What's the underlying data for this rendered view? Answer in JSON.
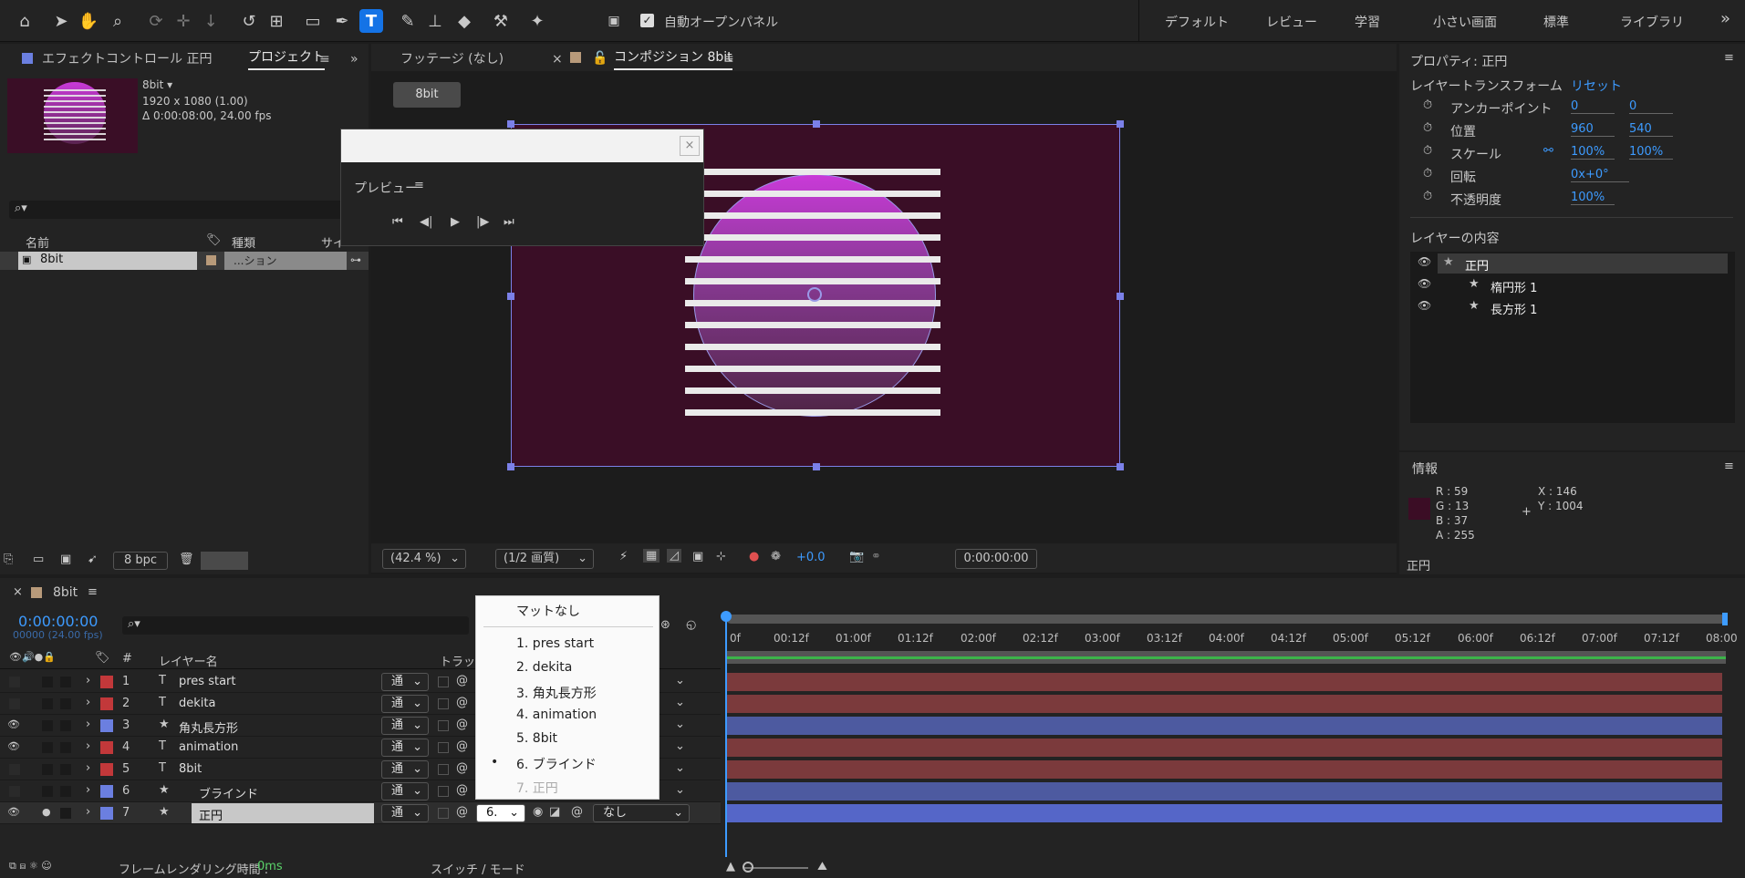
{
  "toolbar": {
    "auto_open_panel": "自動オープンパネル",
    "workspaces": [
      "デフォルト",
      "レビュー",
      "学習",
      "小さい画面",
      "標準",
      "ライブラリ"
    ],
    "more": "»"
  },
  "left_panel": {
    "tab_effects": "エフェクトコントロール 正円",
    "tab_project": "プロジェクト",
    "item_name": "8bit ▾",
    "item_res": "1920 x 1080 (1.00)",
    "item_dur": "Δ 0:00:08:00, 24.00 fps",
    "col_name": "名前",
    "col_type": "種類",
    "col_size": "サイ",
    "row_name": "8bit",
    "row_type": "...ション",
    "bpc": "8 bpc"
  },
  "viewer": {
    "tab_footage": "フッテージ (なし)",
    "tab_comp": "コンポジション 8bit",
    "breadcrumb": "8bit",
    "zoom": "(42.4 %)",
    "quality": "(1/2 画質)",
    "exposure": "+0.0",
    "timecode": "0:00:00:00"
  },
  "preview": {
    "title": "プレビュー"
  },
  "properties": {
    "title": "プロパティ: 正円",
    "section": "レイヤートランスフォーム",
    "reset": "リセット",
    "anchor_label": "アンカーポイント",
    "anchor_x": "0",
    "anchor_y": "0",
    "position_label": "位置",
    "position_x": "960",
    "position_y": "540",
    "scale_label": "スケール",
    "scale_x": "100%",
    "scale_y": "100%",
    "rotation_label": "回転",
    "rotation": "0x+0°",
    "opacity_label": "不透明度",
    "opacity": "100%",
    "contents_title": "レイヤーの内容",
    "contents": [
      "正円",
      "楕円形 1",
      "長方形 1"
    ]
  },
  "info": {
    "title": "情報",
    "r": "R : 59",
    "g": "G : 13",
    "b": "B : 37",
    "a": "A : 255",
    "x": "X : 146",
    "y": "Y : 1004",
    "footer": "正円"
  },
  "timeline": {
    "tab": "8bit",
    "timecode": "0:00:00:00",
    "fps": "00000 (24.00 fps)",
    "col_num": "#",
    "col_name": "レイヤー名",
    "col_track": "トラック",
    "frame_time_label": "フレームレンダリング時間 :",
    "frame_time": "0ms",
    "switch_mode": "スイッチ / モード",
    "ticks": [
      "0f",
      "00:12f",
      "01:00f",
      "01:12f",
      "02:00f",
      "02:12f",
      "03:00f",
      "03:12f",
      "04:00f",
      "04:12f",
      "05:00f",
      "05:12f",
      "06:00f",
      "06:12f",
      "07:00f",
      "07:12f",
      "08:00"
    ],
    "layers": [
      {
        "num": "1",
        "name": "pres start",
        "mode": "通"
      },
      {
        "num": "2",
        "name": "dekita",
        "mode": "通"
      },
      {
        "num": "3",
        "name": "角丸長方形",
        "mode": "通"
      },
      {
        "num": "4",
        "name": "animation",
        "mode": "通"
      },
      {
        "num": "5",
        "name": "8bit",
        "mode": "通"
      },
      {
        "num": "6",
        "name": "ブラインド",
        "mode": "通"
      },
      {
        "num": "7",
        "name": "正円",
        "mode": "通"
      }
    ],
    "row7_matte": "6.",
    "row7_parent": "なし"
  },
  "matte_menu": {
    "header": "マットなし",
    "items": [
      "1. pres start",
      "2. dekita",
      "3. 角丸長方形",
      "4. animation",
      "5. 8bit",
      "6. ブラインド",
      "7. 正円"
    ],
    "bullet": "•"
  },
  "colors": {
    "accent": "#3d9bff",
    "comp_bg": "#3a0e26",
    "layer_red": "#7b3a3c",
    "layer_blue": "#4d5aa0",
    "label_red": "#c2383a",
    "label_blue": "#6b7fe0"
  }
}
